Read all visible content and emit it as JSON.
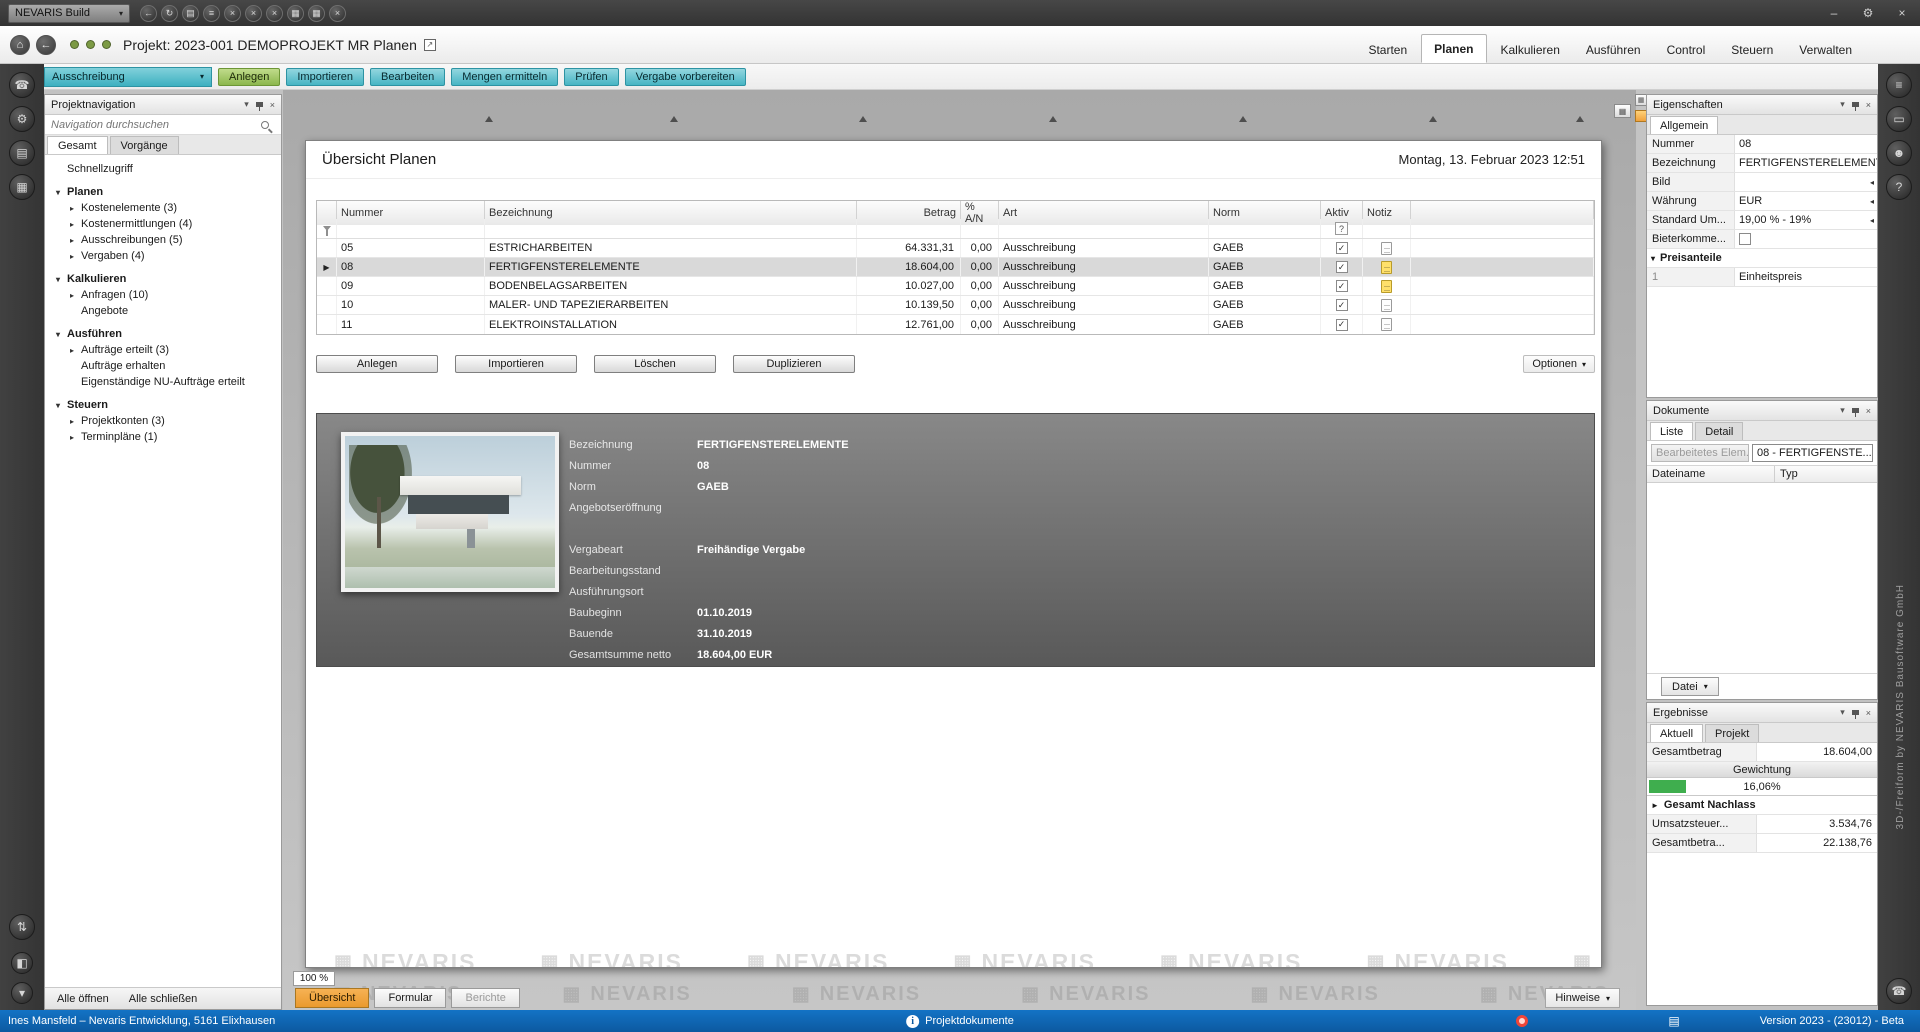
{
  "icons": {
    "chevron_down": "▾",
    "close": "×",
    "minimize": "–",
    "settings": "⚙",
    "row_marker": "▶",
    "external": "↗",
    "home": "⌂",
    "back": "←",
    "grid": "▦",
    "doc": "▤",
    "info": "i",
    "question": "?"
  },
  "colors": {
    "accent_teal": "#47b5c4",
    "accent_green": "#8cb74d",
    "statusbar_blue": "#0c59a0",
    "active_tab_orange": "#ea9a2e",
    "progress_green": "#3fae4e",
    "status_dot_green": "#7c9a44"
  },
  "titlebar": {
    "app_button_label": "NEVARIS Build",
    "quick_access_icons": [
      {
        "name": "nav-back-icon",
        "glyph": "←"
      },
      {
        "name": "refresh-icon",
        "glyph": "↻"
      },
      {
        "name": "document-icon",
        "glyph": "▤"
      },
      {
        "name": "list-icon",
        "glyph": "≡"
      },
      {
        "name": "close-window-icon",
        "glyph": "×"
      },
      {
        "name": "close-tab-icon",
        "glyph": "×"
      },
      {
        "name": "close-all-icon",
        "glyph": "×"
      },
      {
        "name": "grid-layout-icon",
        "glyph": "▦"
      },
      {
        "name": "window-layout-icon",
        "glyph": "▦"
      },
      {
        "name": "exit-icon",
        "glyph": "×"
      }
    ]
  },
  "project_bar": {
    "project_label": "Projekt: 2023-001 DEMOPROJEKT MR Planen",
    "status_dots": [
      "#7c9a44",
      "#7c9a44",
      "#7c9a44"
    ],
    "tabs": [
      {
        "label": "Starten"
      },
      {
        "label": "Planen"
      },
      {
        "label": "Kalkulieren"
      },
      {
        "label": "Ausführen"
      },
      {
        "label": "Control"
      },
      {
        "label": "Steuern"
      },
      {
        "label": "Verwalten"
      }
    ]
  },
  "ribbon": {
    "module_selector": "Ausschreibung",
    "buttons": [
      "Anlegen",
      "Importieren",
      "Bearbeiten",
      "Mengen ermitteln",
      "Prüfen",
      "Vergabe vorbereiten"
    ]
  },
  "left_strip": {
    "top_icons": [
      {
        "name": "support-icon",
        "glyph": "☎"
      },
      {
        "name": "settings-icon",
        "glyph": "⚙"
      },
      {
        "name": "news-icon",
        "glyph": "▤"
      },
      {
        "name": "apps-icon",
        "glyph": "▦"
      }
    ],
    "bottom_icons": [
      {
        "name": "sync-icon",
        "glyph": "⇅"
      },
      {
        "name": "panel-toggle-icon",
        "glyph": "◧"
      },
      {
        "name": "collapse-icon",
        "glyph": "▾"
      }
    ]
  },
  "right_strip": {
    "top_icons": [
      {
        "name": "menu-icon",
        "glyph": "≡"
      },
      {
        "name": "monitor-icon",
        "glyph": "▭"
      },
      {
        "name": "user-icon",
        "glyph": "☻"
      },
      {
        "name": "help-icon",
        "glyph": "?"
      }
    ],
    "bottom_icons": [
      {
        "name": "phone-icon",
        "glyph": "☎"
      }
    ]
  },
  "navigation": {
    "panel_title": "Projektnavigation",
    "search_placeholder": "Navigation durchsuchen",
    "tabs": [
      "Gesamt",
      "Vorgänge"
    ],
    "quick_access_label": "Schnellzugriff",
    "tree": [
      {
        "label": "Planen",
        "arrow": "▾"
      },
      {
        "label": "Kostenelemente (3)",
        "arrow": "▸"
      },
      {
        "label": "Kostenermittlungen (4)",
        "arrow": "▸"
      },
      {
        "label": "Ausschreibungen (5)",
        "arrow": "▸"
      },
      {
        "label": "Vergaben (4)",
        "arrow": "▸"
      },
      {
        "label": "Kalkulieren",
        "arrow": "▾"
      },
      {
        "label": "Anfragen (10)",
        "arrow": "▸"
      },
      {
        "label": "Angebote",
        "arrow": ""
      },
      {
        "label": "Ausführen",
        "arrow": "▾"
      },
      {
        "label": "Aufträge erteilt (3)",
        "arrow": "▸"
      },
      {
        "label": "Aufträge erhalten",
        "arrow": ""
      },
      {
        "label": "Eigenständige NU-Aufträge erteilt",
        "arrow": ""
      },
      {
        "label": "Steuern",
        "arrow": "▾"
      },
      {
        "label": "Projektkonten (3)",
        "arrow": "▸"
      },
      {
        "label": "Terminpläne (1)",
        "arrow": "▸"
      }
    ],
    "footer_buttons": [
      "Alle öffnen",
      "Alle schließen"
    ]
  },
  "main": {
    "page_title": "Übersicht Planen",
    "datetime": "Montag, 13. Februar 2023 12:51",
    "table": {
      "columns": [
        "Nummer",
        "Bezeichnung",
        "Betrag",
        "% A/N",
        "Art",
        "Norm",
        "Aktiv",
        "Notiz"
      ],
      "filter_hint": "?",
      "rows": [
        {
          "nummer": "05",
          "bezeichnung": "ESTRICHARBEITEN",
          "betrag": "64.331,31",
          "an": "0,00",
          "art": "Ausschreibung",
          "norm": "GAEB",
          "aktiv": "✓",
          "notiz": "plain"
        },
        {
          "nummer": "08",
          "bezeichnung": "FERTIGFENSTERELEMENTE",
          "betrag": "18.604,00",
          "an": "0,00",
          "art": "Ausschreibung",
          "norm": "GAEB",
          "aktiv": "✓",
          "notiz": "note"
        },
        {
          "nummer": "09",
          "bezeichnung": "BODENBELAGSARBEITEN",
          "betrag": "10.027,00",
          "an": "0,00",
          "art": "Ausschreibung",
          "norm": "GAEB",
          "aktiv": "✓",
          "notiz": "note"
        },
        {
          "nummer": "10",
          "bezeichnung": "MALER- UND TAPEZIERARBEITEN",
          "betrag": "10.139,50",
          "an": "0,00",
          "art": "Ausschreibung",
          "norm": "GAEB",
          "aktiv": "✓",
          "notiz": "plain"
        },
        {
          "nummer": "11",
          "bezeichnung": "ELEKTROINSTALLATION",
          "betrag": "12.761,00",
          "an": "0,00",
          "art": "Ausschreibung",
          "norm": "GAEB",
          "aktiv": "✓",
          "notiz": "plain"
        }
      ]
    },
    "action_buttons": [
      "Anlegen",
      "Importieren",
      "Löschen",
      "Duplizieren"
    ],
    "options_button": "Optionen",
    "detail_card": {
      "fields": [
        {
          "label": "Bezeichnung",
          "value": "FERTIGFENSTERELEMENTE"
        },
        {
          "label": "Nummer",
          "value": "08"
        },
        {
          "label": "Norm",
          "value": "GAEB"
        },
        {
          "label": "Angebotseröffnung",
          "value": ""
        },
        {
          "label": "Vergabeart",
          "value": "Freihändige Vergabe"
        },
        {
          "label": "Bearbeitungsstand",
          "value": ""
        },
        {
          "label": "Ausführungsort",
          "value": ""
        },
        {
          "label": "Baubeginn",
          "value": "01.10.2019"
        },
        {
          "label": "Bauende",
          "value": "31.10.2019"
        },
        {
          "label": "Gesamtsum­me netto",
          "value": "18.604,00 EUR"
        }
      ]
    },
    "watermark_text": "NEVARIS",
    "zoom_level": "100 %",
    "bottom_tabs": [
      "Übersicht",
      "Formular",
      "Berichte"
    ],
    "hinweise_button": "Hinweise"
  },
  "properties": {
    "panel_title": "Eigenschaften",
    "tab": "Allgemein",
    "rows": [
      {
        "label": "Nummer",
        "value": "08",
        "arrow": ""
      },
      {
        "label": "Bezeichnung",
        "value": "FERTIGFENSTERELEMENT",
        "arrow": "◂"
      },
      {
        "label": "Bild",
        "value": "",
        "arrow": "◂"
      },
      {
        "label": "Währung",
        "value": "EUR",
        "arrow": "◂"
      },
      {
        "label": "Standard Um...",
        "value": "19,00 % - 19%",
        "arrow": "◂"
      },
      {
        "label": "Bieterkomme...",
        "value": "",
        "arrow": ""
      }
    ],
    "section_arrow": "▾",
    "section_label": "Preisanteile",
    "section_rows": [
      {
        "label": "1",
        "value": "Einheitspreis"
      }
    ]
  },
  "documents": {
    "panel_title": "Dokumente",
    "tabs": [
      "Liste",
      "Detail"
    ],
    "edited_element_label": "Bearbeitetes Elem...",
    "edited_element_value": "08 - FERTIGFENSTE...",
    "columns": [
      "Dateiname",
      "Typ"
    ],
    "file_button": "Datei"
  },
  "results": {
    "panel_title": "Ergebnisse",
    "tabs": [
      "Aktuell",
      "Projekt"
    ],
    "gesamtbetrag_label": "Gesamtbetrag",
    "gesamtbetrag_value": "18.604,00",
    "gewichtung_label": "Gewichtung",
    "gewichtung_value": "16,06%",
    "bar_color": "#3fae4e",
    "nachlass_arrow": "►",
    "nachlass_label": "Gesamt Nachlass",
    "rows": [
      {
        "label": "Umsatzsteuer...",
        "value": "3.534,76"
      },
      {
        "label": "Gesamtbetra...",
        "value": "22.138,76"
      }
    ]
  },
  "statusbar": {
    "user_info": "Ines Mansfeld – Nevaris Entwicklung, 5161 Elixhausen",
    "center_label": "Projektdokumente",
    "version": "Version 2023 - (23012) - Beta"
  },
  "side_watermark": "3D-/Freiform by NEVARIS Bausoftware GmbH"
}
